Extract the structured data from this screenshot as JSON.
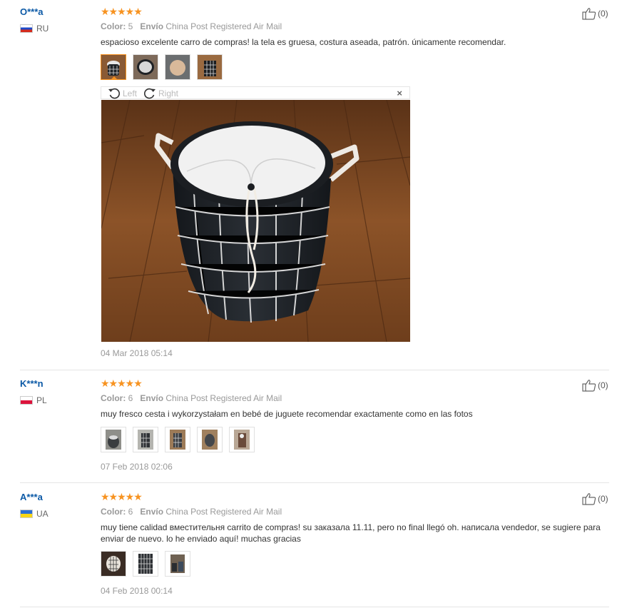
{
  "reviews": [
    {
      "user": "O***a",
      "country": "RU",
      "stars": "★★★★★",
      "color_label": "Color:",
      "color_value": "5",
      "shipping_label": "Envío",
      "shipping_value": "China Post Registered Air Mail",
      "text": "espacioso excelente carro de compras! la tela es gruesa, costura aseada, patrón. únicamente recomendar.",
      "likes": "(0)",
      "date": "04 Mar 2018 05:14",
      "photo_count": 4,
      "viewer": {
        "left_label": "Left",
        "right_label": "Right",
        "close_symbol": "×"
      }
    },
    {
      "user": "K***n",
      "country": "PL",
      "stars": "★★★★★",
      "color_label": "Color:",
      "color_value": "6",
      "shipping_label": "Envío",
      "shipping_value": "China Post Registered Air Mail",
      "text": "muy fresco cesta i wykorzystałam en bebé de juguete recomendar exactamente como en las fotos",
      "likes": "(0)",
      "date": "07 Feb 2018 02:06",
      "photo_count": 5
    },
    {
      "user": "A***a",
      "country": "UA",
      "stars": "★★★★★",
      "color_label": "Color:",
      "color_value": "6",
      "shipping_label": "Envío",
      "shipping_value": "China Post Registered Air Mail",
      "text": "muy tiene calidad вместительня carrito de compras! su заказала 11.11, pero no final llegó oh. написала vendedor, se sugiere para enviar de nuevo. lo he enviado aquí! muchas gracias",
      "likes": "(0)",
      "date": "04 Feb 2018 00:14",
      "photo_count": 3
    }
  ],
  "colors": {
    "star": "#f79321",
    "user": "#0b59a6",
    "muted": "#999999"
  }
}
